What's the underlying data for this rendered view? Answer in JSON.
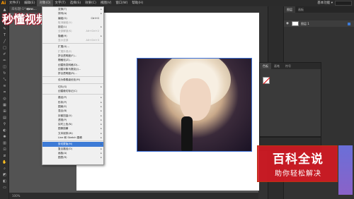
{
  "app": {
    "logo": "Ai"
  },
  "menubar": {
    "items": [
      {
        "label": "文件(F)"
      },
      {
        "label": "编辑(E)"
      },
      {
        "label": "对象(O)"
      },
      {
        "label": "文字(T)"
      },
      {
        "label": "选择(S)"
      },
      {
        "label": "效果(C)"
      },
      {
        "label": "视图(V)"
      },
      {
        "label": "窗口(W)"
      },
      {
        "label": "帮助(H)"
      }
    ],
    "workspace": "基本功能 ▾"
  },
  "watermark": {
    "tag": "www.…",
    "text": "秒懂视频"
  },
  "document": {
    "tab": "未标题-1* @ …",
    "status": "100%"
  },
  "object_menu": [
    {
      "label": "变换(T)",
      "shortcut": "",
      "arrow": "▸",
      "disabled": false
    },
    {
      "label": "排列(A)",
      "shortcut": "",
      "arrow": "▸",
      "disabled": false
    },
    {
      "label": "编组(G)",
      "shortcut": "Ctrl+G",
      "arrow": "",
      "disabled": false
    },
    {
      "label": "取消编组(U)",
      "shortcut": "",
      "arrow": "",
      "disabled": true
    },
    {
      "label": "锁定(L)",
      "shortcut": "",
      "arrow": "▸",
      "disabled": false
    },
    {
      "label": "全部解锁(K)",
      "shortcut": "Alt+Ctrl+2",
      "arrow": "",
      "disabled": true
    },
    {
      "label": "隐藏(H)",
      "shortcut": "",
      "arrow": "▸",
      "disabled": false
    },
    {
      "label": "显示全部",
      "shortcut": "Alt+Ctrl+3",
      "arrow": "",
      "disabled": true
    },
    {
      "sep": true
    },
    {
      "label": "扩展(X)...",
      "shortcut": "",
      "arrow": "",
      "disabled": false
    },
    {
      "label": "扩展外观(E)",
      "shortcut": "",
      "arrow": "",
      "disabled": true
    },
    {
      "label": "拼合透明度(F)...",
      "shortcut": "",
      "arrow": "",
      "disabled": false
    },
    {
      "label": "栅格化(Z)...",
      "shortcut": "",
      "arrow": "",
      "disabled": false
    },
    {
      "label": "创建渐变网格(D)...",
      "shortcut": "",
      "arrow": "",
      "disabled": false
    },
    {
      "label": "创建对象马赛克(J)...",
      "shortcut": "",
      "arrow": "",
      "disabled": false
    },
    {
      "label": "拼合透明度(R)...",
      "shortcut": "",
      "arrow": "",
      "disabled": false
    },
    {
      "sep": true
    },
    {
      "label": "设为像素级优化(M)",
      "shortcut": "",
      "arrow": "",
      "disabled": false
    },
    {
      "sep": true
    },
    {
      "label": "切片(S)",
      "shortcut": "",
      "arrow": "▸",
      "disabled": false
    },
    {
      "label": "创建裁切标记(C)",
      "shortcut": "",
      "arrow": "",
      "disabled": false
    },
    {
      "sep": true
    },
    {
      "label": "路径(P)",
      "shortcut": "",
      "arrow": "▸",
      "disabled": false
    },
    {
      "label": "形状(P)",
      "shortcut": "",
      "arrow": "▸",
      "disabled": false
    },
    {
      "label": "图案(E)",
      "shortcut": "",
      "arrow": "▸",
      "disabled": false
    },
    {
      "label": "混合(B)",
      "shortcut": "",
      "arrow": "▸",
      "disabled": false
    },
    {
      "label": "封套扭曲(V)",
      "shortcut": "",
      "arrow": "▸",
      "disabled": false
    },
    {
      "label": "透视(P)",
      "shortcut": "",
      "arrow": "▸",
      "disabled": false
    },
    {
      "label": "实时上色(N)",
      "shortcut": "",
      "arrow": "▸",
      "disabled": false
    },
    {
      "label": "图像描摹",
      "shortcut": "",
      "arrow": "▸",
      "disabled": false
    },
    {
      "label": "文本绕排(W)",
      "shortcut": "",
      "arrow": "▸",
      "disabled": false
    },
    {
      "label": "Line 和 Sketch 图稿",
      "shortcut": "",
      "arrow": "▸",
      "disabled": false
    },
    {
      "sep": true
    },
    {
      "label": "剪切蒙版(M)",
      "shortcut": "",
      "arrow": "▸",
      "disabled": false,
      "hover": true
    },
    {
      "label": "复合路径(O)",
      "shortcut": "",
      "arrow": "▸",
      "disabled": false
    },
    {
      "label": "画板(A)",
      "shortcut": "",
      "arrow": "▸",
      "disabled": false
    },
    {
      "label": "图表(R)",
      "shortcut": "",
      "arrow": "▸",
      "disabled": false
    }
  ],
  "layers_panel": {
    "tabs": [
      "图层",
      "画板"
    ],
    "layer_name": "图层 1"
  },
  "swatch_panel": {
    "tabs": [
      "色板",
      "画笔",
      "符号"
    ]
  },
  "brand": {
    "title": "百科全说",
    "subtitle": "助你轻松解决"
  }
}
